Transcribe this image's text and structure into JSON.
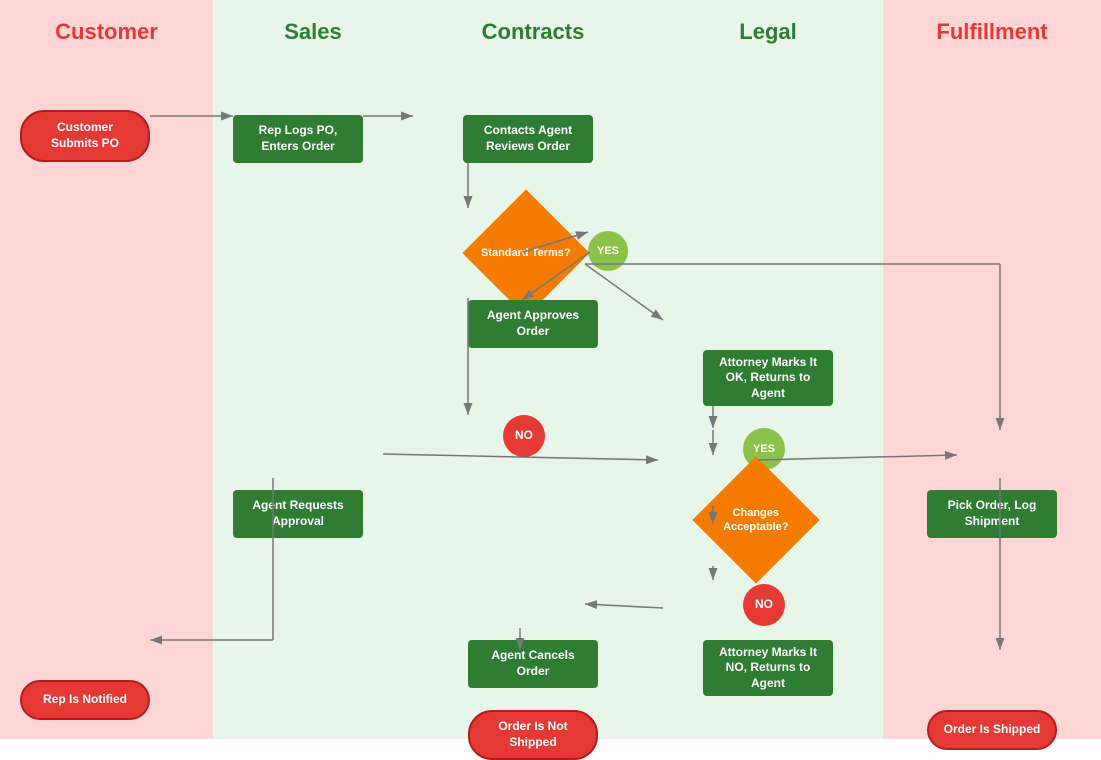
{
  "lanes": [
    {
      "id": "customer",
      "label": "Customer",
      "color": "red"
    },
    {
      "id": "sales",
      "label": "Sales",
      "color": "green"
    },
    {
      "id": "contracts",
      "label": "Contracts",
      "color": "green"
    },
    {
      "id": "legal",
      "label": "Legal",
      "color": "green"
    },
    {
      "id": "fulfillment",
      "label": "Fulfillment",
      "color": "red"
    }
  ],
  "nodes": {
    "customer_submits_po": "Customer Submits PO",
    "rep_logs_po": "Rep Logs PO, Enters Order",
    "contacts_agent": "Contacts Agent Reviews Order",
    "standard_terms": "Standard Terms?",
    "yes1": "YES",
    "agent_approves": "Agent Approves Order",
    "no1": "NO",
    "agent_requests": "Agent Requests Approval",
    "changes_acceptable": "Changes Acceptable?",
    "yes2": "YES",
    "no2": "NO",
    "attorney_ok": "Attorney Marks It OK, Returns to Agent",
    "attorney_no": "Attorney Marks It NO, Returns to Agent",
    "agent_cancels": "Agent Cancels Order",
    "rep_notified": "Rep Is Notified",
    "order_not_shipped": "Order Is Not Shipped",
    "pick_order": "Pick Order, Log Shipment",
    "order_shipped": "Order Is Shipped"
  }
}
